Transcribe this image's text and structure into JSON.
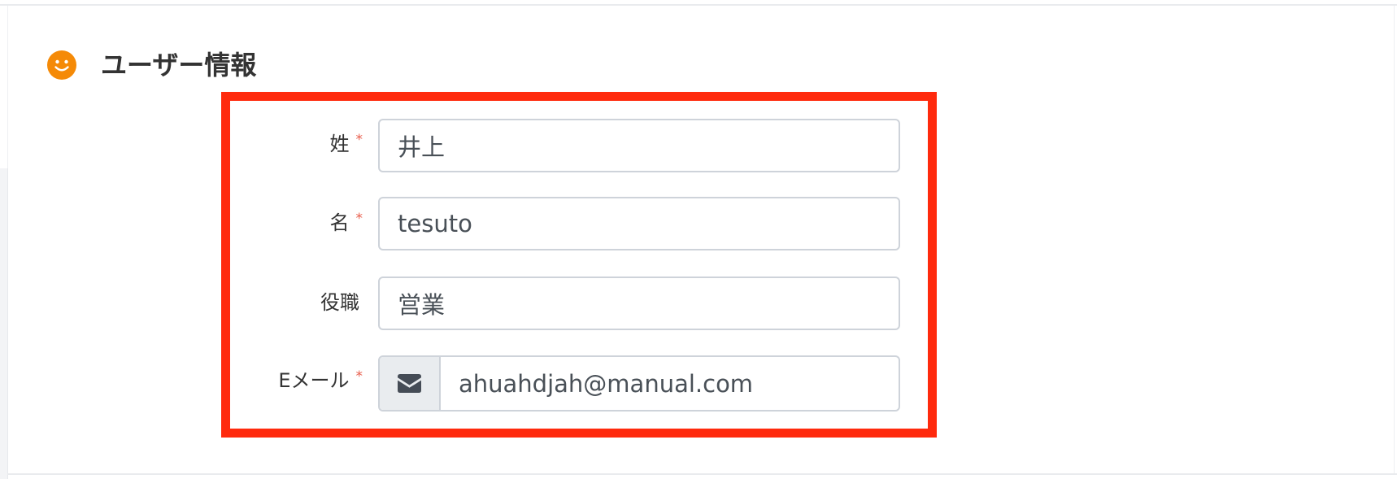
{
  "section": {
    "title": "ユーザー情報",
    "icon": "smiley-icon",
    "icon_color": "#f58a07"
  },
  "highlight": {
    "color": "#ff2a0d"
  },
  "form": {
    "required_mark": "*",
    "last_name": {
      "label": "姓",
      "required": true,
      "value": "井上"
    },
    "first_name": {
      "label": "名",
      "required": true,
      "value": "tesuto"
    },
    "position": {
      "label": "役職",
      "required": false,
      "value": "営業"
    },
    "email": {
      "label": "Eメール",
      "required": true,
      "value": "ahuahdjah@manual.com",
      "icon": "envelope-icon"
    }
  }
}
